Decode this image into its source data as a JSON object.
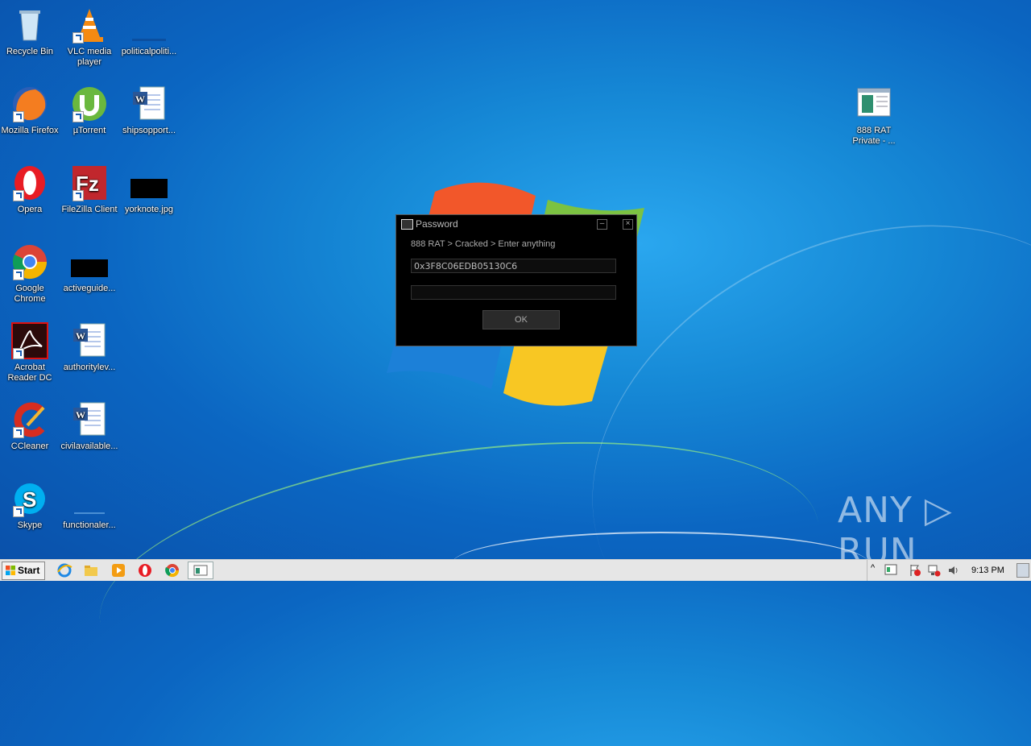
{
  "desktop": {
    "icons": [
      {
        "label": "Recycle Bin"
      },
      {
        "label": "VLC media player"
      },
      {
        "label": "politicalpoliti..."
      },
      {
        "label": "Mozilla Firefox"
      },
      {
        "label": "µTorrent"
      },
      {
        "label": "shipsopport..."
      },
      {
        "label": "Opera"
      },
      {
        "label": "FileZilla Client"
      },
      {
        "label": "yorknote.jpg"
      },
      {
        "label": "Google Chrome"
      },
      {
        "label": "activeguide..."
      },
      {
        "label": "Acrobat Reader DC"
      },
      {
        "label": "authoritylev..."
      },
      {
        "label": "CCleaner"
      },
      {
        "label": "civilavailable..."
      },
      {
        "label": "Skype"
      },
      {
        "label": "functionaler..."
      },
      {
        "label": "888 RAT Private - ..."
      }
    ]
  },
  "dialog": {
    "title": "Password",
    "subtitle": "888 RAT > Cracked > Enter anything",
    "field1_value": "0x3F8C06EDB05130C6",
    "field2_value": "",
    "ok_label": "OK",
    "minimize_glyph": "–",
    "close_glyph": "×"
  },
  "taskbar": {
    "start_label": "Start",
    "clock": "9:13 PM"
  },
  "watermark": "ANY ▷ RUN",
  "colors": {
    "desktop_blue": "#0b66c2",
    "dialog_bg": "#000000",
    "taskbar_bg": "#e6e6e6"
  }
}
